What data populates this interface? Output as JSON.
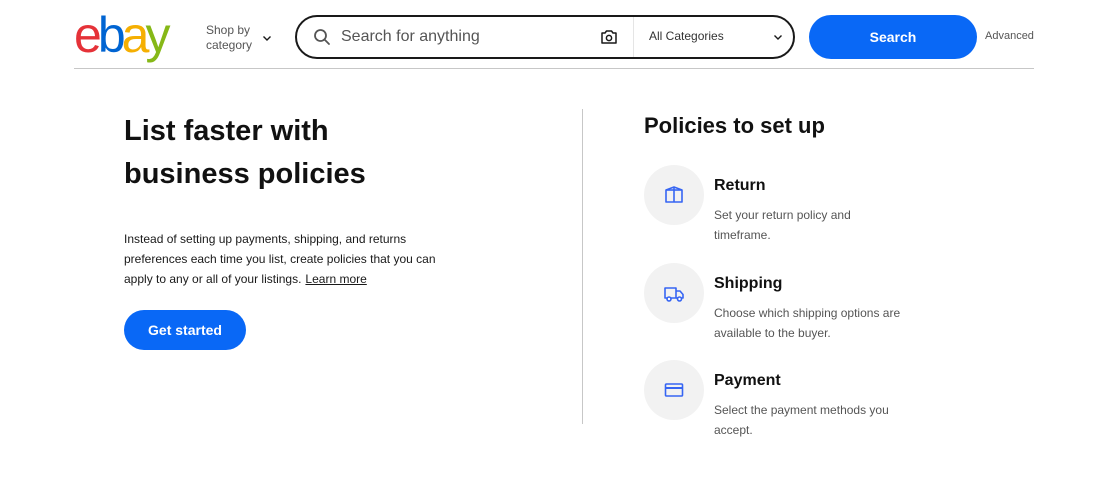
{
  "header": {
    "logo": {
      "letters": [
        "e",
        "b",
        "a",
        "y"
      ],
      "colors": [
        "#e53238",
        "#0064d2",
        "#f5af02",
        "#86b817"
      ]
    },
    "shop_by_line1": "Shop by",
    "shop_by_line2": "category",
    "search_placeholder": "Search for anything",
    "category_selected": "All Categories",
    "search_button": "Search",
    "advanced_link": "Advanced"
  },
  "intro": {
    "heading": "List faster with business policies",
    "body": "Instead of setting up payments, shipping, and returns preferences each time you list, create policies that you can apply to any or all of your listings.",
    "learn_more": "Learn more",
    "cta": "Get started"
  },
  "policies": {
    "heading": "Policies to set up",
    "items": [
      {
        "icon": "box-icon",
        "title": "Return",
        "description": "Set your return policy and timeframe."
      },
      {
        "icon": "truck-icon",
        "title": "Shipping",
        "description": "Choose which shipping options are available to the buyer."
      },
      {
        "icon": "card-icon",
        "title": "Payment",
        "description": "Select the payment methods you accept."
      }
    ]
  },
  "colors": {
    "accent": "#0968f6",
    "icon": "#3665f3",
    "circle_bg": "#f2f2f2"
  }
}
